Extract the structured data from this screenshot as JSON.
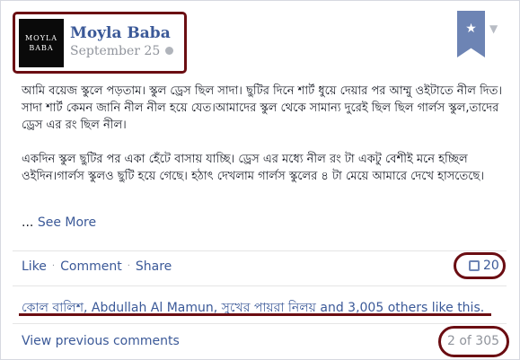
{
  "post": {
    "author": "Moyla Baba",
    "avatar_text_line1": "MOYLA",
    "avatar_text_line2": "BABA",
    "date": "September 25",
    "body_para1": "আমি বয়েজ স্কুলে পড়তাম। স্কুল ড্রেস ছিল সাদা। ছুটির দিনে শার্ট ধুয়ে দেয়ার পর আম্মু ওইটাতে নীল দিত।সাদা শার্ট কেমন জানি নীল নীল হয়ে যেত।আমাদের স্কুল থেকে সামান্য দুরেই ছিল ছিল গার্লস স্কুল,তাদের ড্রেস এর রং ছিল নীল।",
    "body_para2": "একদিন স্কুল ছুটির পর একা হেঁটে বাসায় যাচ্ছি। ড্রেস এর মধ্যে নীল রং টা একটু বেশীই মনে হচ্ছিল ওইদিন।গার্লস স্কুলও ছুটি হয়ে গেছে। হঠাৎ দেখলাম গার্লস স্কুলের ৪ টা মেয়ে আমারে দেখে হাসতেছে।",
    "see_more_dots": "...",
    "see_more": "See More"
  },
  "actions": {
    "like": "Like",
    "comment": "Comment",
    "share": "Share",
    "separator": "·",
    "comment_count": "20"
  },
  "likes_text": "কোল বালিশ, Abdullah Al Mamun, সুখের পায়রা নিলয় and 3,005 others like this.",
  "comments": {
    "view_previous": "View previous comments",
    "pager": "2 of 305"
  },
  "colors": {
    "link": "#3b5998",
    "annotation": "#6b0d12",
    "bookmark": "#6d84b4"
  },
  "icons": [
    "globe-icon",
    "bookmark-star-icon",
    "chevron-down-icon",
    "comment-icon"
  ]
}
